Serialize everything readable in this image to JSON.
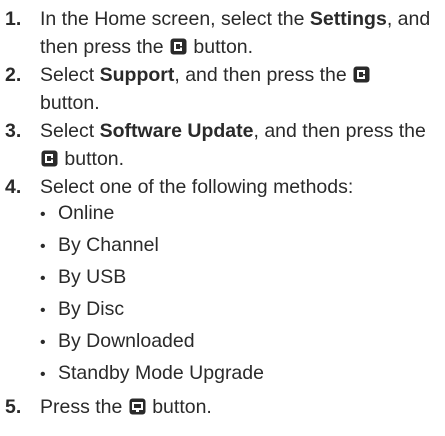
{
  "steps": [
    {
      "number": "1.",
      "line1_pre": "In the Home screen, select the ",
      "line1_bold": "Settings",
      "line1_post": ", and",
      "line2_pre": "then press the ",
      "line2_post": " button.",
      "icon": "enter-button-icon"
    },
    {
      "number": "2.",
      "line1_pre": "Select ",
      "line1_bold": "Support",
      "line1_post": ", and then press the ",
      "line2_text": "button.",
      "icon": "enter-button-icon"
    },
    {
      "number": "3.",
      "line1_pre": "Select ",
      "line1_bold": "Software Update",
      "line1_post": ", and then press the",
      "line2_post": " button.",
      "icon": "enter-button-icon"
    },
    {
      "number": "4.",
      "text": "Select one of the following methods:",
      "methods": [
        "Online",
        "By Channel",
        "By USB",
        "By Disc",
        "By Downloaded",
        "Standby Mode Upgrade"
      ]
    },
    {
      "number": "5.",
      "pre": "Press the ",
      "post": " button.",
      "icon": "tools-button-icon"
    }
  ],
  "bullet_char": "•"
}
